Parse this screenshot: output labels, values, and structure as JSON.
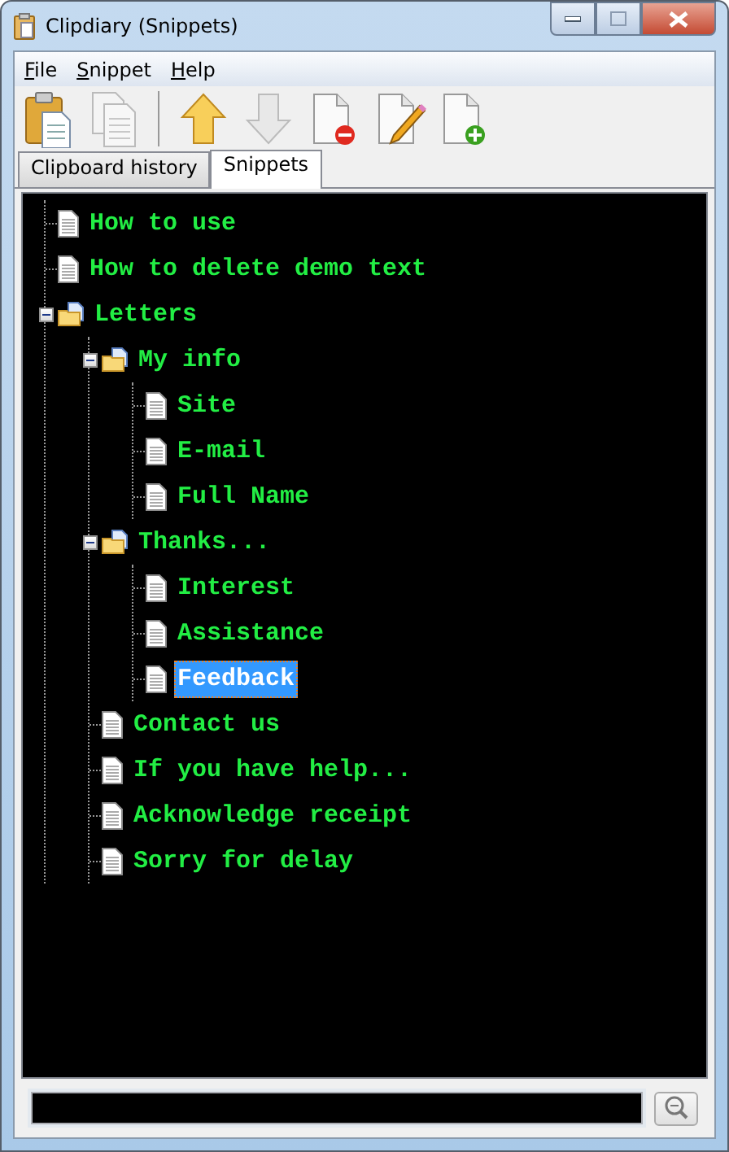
{
  "window": {
    "title": "Clipdiary (Snippets)"
  },
  "menu": [
    "File",
    "Snippet",
    "Help"
  ],
  "toolbar": [
    {
      "kind": "paste",
      "disabled": false
    },
    {
      "kind": "copy",
      "disabled": true
    },
    {
      "kind": "separator"
    },
    {
      "kind": "up",
      "disabled": false
    },
    {
      "kind": "down",
      "disabled": true
    },
    {
      "kind": "delete",
      "disabled": false
    },
    {
      "kind": "edit",
      "disabled": false
    },
    {
      "kind": "add",
      "disabled": false
    }
  ],
  "tabs": [
    {
      "label": "Clipboard history",
      "selected": false
    },
    {
      "label": "Snippets",
      "selected": true
    }
  ],
  "tree": [
    {
      "label": "How to use",
      "kind": "snippet",
      "selected": false
    },
    {
      "label": "How to delete demo text",
      "kind": "snippet",
      "selected": false
    },
    {
      "label": "Letters",
      "kind": "folder",
      "expanded": true,
      "selected": false,
      "children": [
        {
          "label": "My info",
          "kind": "folder",
          "expanded": true,
          "selected": false,
          "children": [
            {
              "label": "Site",
              "kind": "snippet",
              "selected": false
            },
            {
              "label": "E-mail",
              "kind": "snippet",
              "selected": false
            },
            {
              "label": "Full Name",
              "kind": "snippet",
              "selected": false
            }
          ]
        },
        {
          "label": "Thanks...",
          "kind": "folder",
          "expanded": true,
          "selected": false,
          "children": [
            {
              "label": "Interest",
              "kind": "snippet",
              "selected": false
            },
            {
              "label": "Assistance",
              "kind": "snippet",
              "selected": false
            },
            {
              "label": "Feedback",
              "kind": "snippet",
              "selected": true
            }
          ]
        },
        {
          "label": "Contact us",
          "kind": "snippet",
          "selected": false
        },
        {
          "label": "If you have help...",
          "kind": "snippet",
          "selected": false
        },
        {
          "label": "Acknowledge receipt",
          "kind": "snippet",
          "selected": false
        },
        {
          "label": "Sorry for delay",
          "kind": "snippet",
          "selected": false
        }
      ]
    }
  ]
}
